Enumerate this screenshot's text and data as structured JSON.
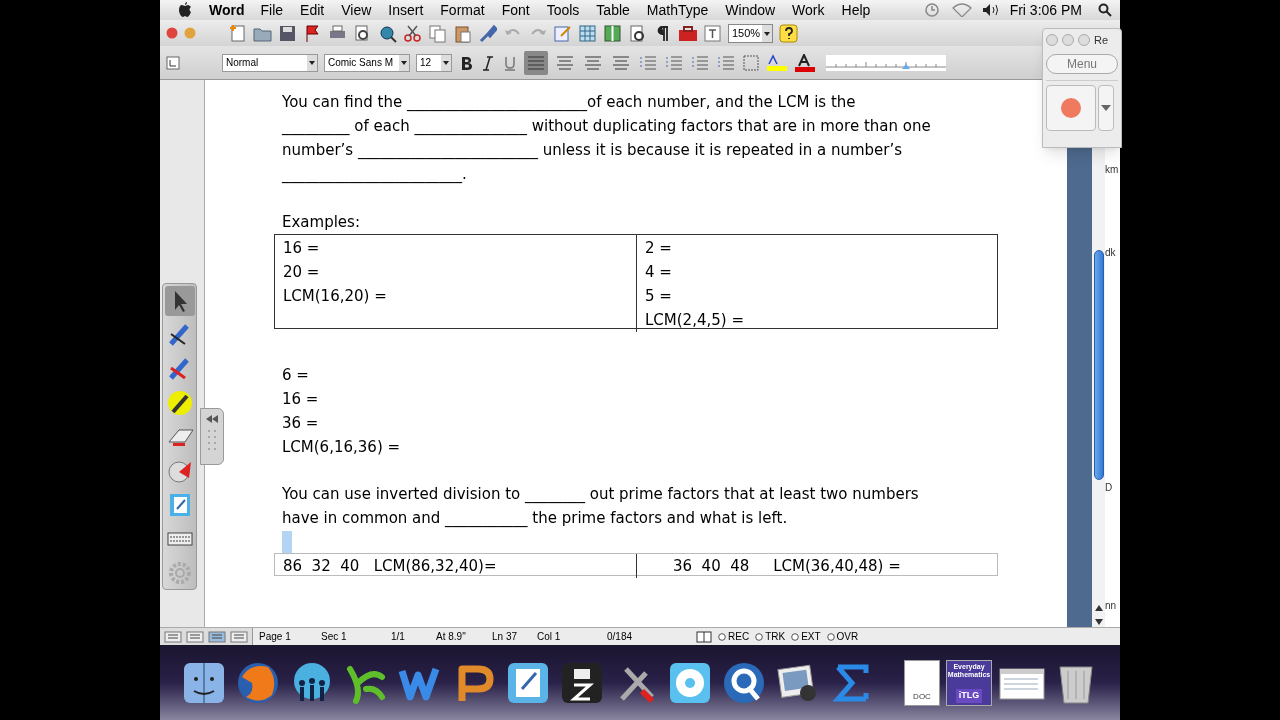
{
  "menu_bar": {
    "app": "Word",
    "items": [
      "File",
      "Edit",
      "View",
      "Insert",
      "Format",
      "Font",
      "Tools",
      "Table",
      "MathType",
      "Window",
      "Work",
      "Help"
    ],
    "clock": "Fri 3:06 PM"
  },
  "formatting_toolbar": {
    "style": "Normal",
    "font": "Comic Sans M",
    "size": "12",
    "zoom": "150%"
  },
  "recorder": {
    "title": "Re",
    "menu": "Menu"
  },
  "document": {
    "paragraph_1": [
      "You can find the ________________________of each number, and the LCM is the",
      "_________ of each _______________ without duplicating factors that are in more than one",
      "number’s ________________________ unless it is because it is repeated in a number’s",
      "________________________."
    ],
    "examples_heading": "Examples:",
    "table_1": [
      [
        "16 =",
        "20 =",
        "LCM(16,20) ="
      ],
      [
        "2 =",
        "4 =",
        "5 =",
        "LCM(2,4,5) ="
      ]
    ],
    "exercise_lines": [
      "6 =",
      "16 =",
      "36 =",
      "LCM(6,16,36) ="
    ],
    "paragraph_2": [
      "You can use inverted division to ________ out prime factors that at least two numbers",
      "have in common and ___________ the prime factors and what is left."
    ],
    "table_2": [
      "86  32  40   LCM(86,32,40)=",
      "36  40  48     LCM(36,40,48) ="
    ]
  },
  "status_bar": {
    "fields": [
      "Page 1",
      "Sec 1",
      "1/1",
      "At 8.9\"",
      "Ln 37",
      "Col 1",
      "0/184"
    ],
    "modes": [
      "REC",
      "TRK",
      "EXT",
      "OVR"
    ]
  },
  "background_window": {
    "fragments": [
      "km",
      "dk",
      "D",
      "nn"
    ]
  },
  "dock": {
    "doc_label": "DOC",
    "itlg_title": "Everyday Mathematics",
    "itlg_label": "iTLG"
  }
}
